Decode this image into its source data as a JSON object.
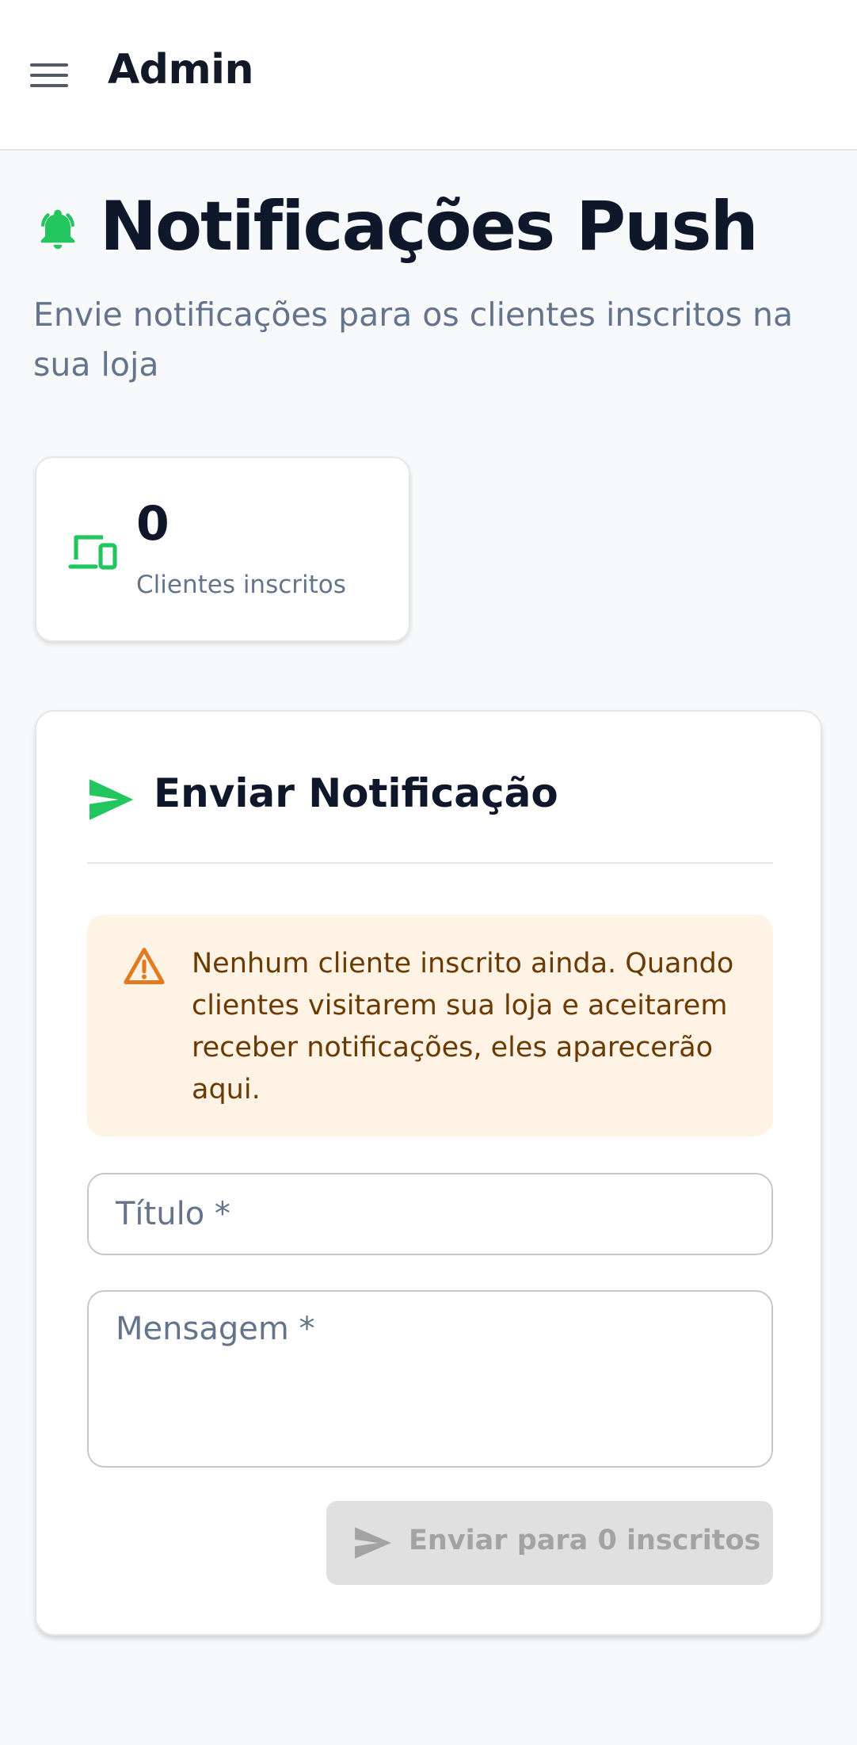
{
  "appbar": {
    "title": "Admin",
    "menu_icon": "hamburger-menu-icon"
  },
  "header": {
    "icon": "bell-icon",
    "title": "Notificações Push",
    "subtitle": "Envie notificações para os clientes inscritos na sua loja"
  },
  "stats": {
    "icon": "devices-icon",
    "value": "0",
    "label": "Clientes inscritos"
  },
  "send_card": {
    "icon": "send-icon",
    "title": "Enviar Notificação",
    "warning": {
      "icon": "warning-triangle-icon",
      "text": "Nenhum cliente inscrito ainda. Quando clientes visitarem sua loja e aceitarem receber notificações, eles aparecerão aqui."
    },
    "title_field": {
      "placeholder": "Título *",
      "value": ""
    },
    "message_field": {
      "placeholder": "Mensagem *",
      "value": ""
    },
    "submit": {
      "label": "Enviar para 0 inscritos",
      "disabled": true
    }
  },
  "colors": {
    "accent_green": "#22c55e",
    "warning_orange": "#e07b1f",
    "warning_bg": "#fff3e6",
    "text_dark": "#0f172a",
    "text_muted": "#64748b"
  }
}
